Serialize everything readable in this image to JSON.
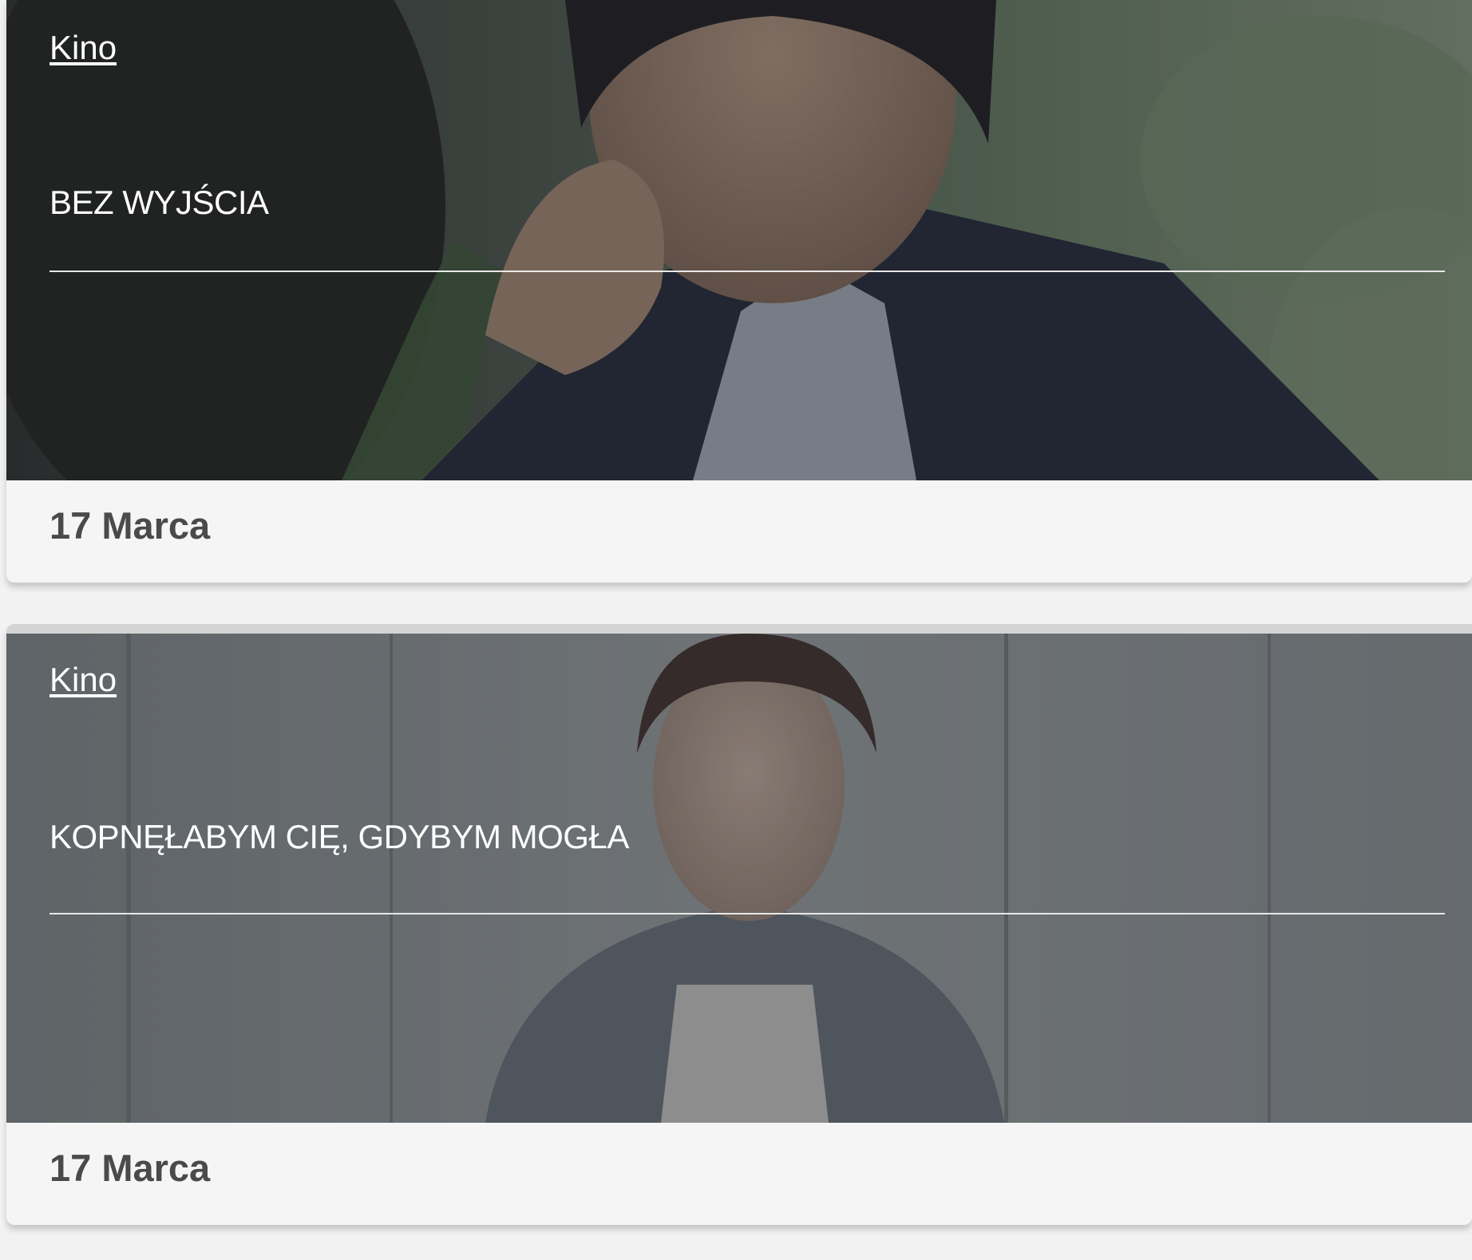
{
  "cards": [
    {
      "category": "Kino",
      "title": "BEZ WYJŚCIA",
      "date": "17 Marca",
      "image": "film-still-man-in-forest"
    },
    {
      "category": "Kino",
      "title": "KOPNĘŁABYM CIĘ, GDYBYM MOGŁA",
      "date": "17 Marca",
      "image": "film-still-woman-against-wall"
    }
  ],
  "colors": {
    "overlay": "#28282c",
    "rule": "#e8e8e8",
    "date_text": "#4a4a4a",
    "card_bg": "#f5f5f5"
  }
}
